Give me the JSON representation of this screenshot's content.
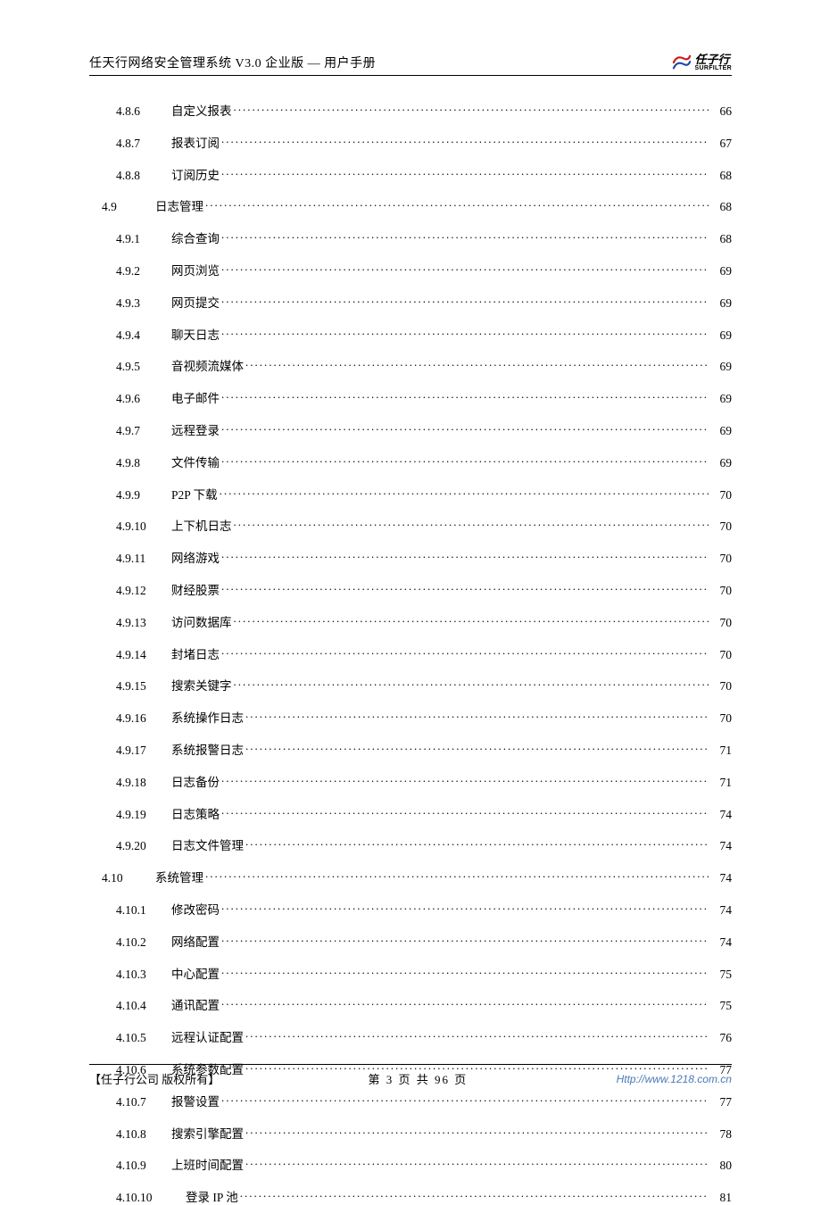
{
  "header": {
    "title": "任天行网络安全管理系统 V3.0 企业版 — 用户手册",
    "logo_cn": "任子行",
    "logo_en": "SURFILTER"
  },
  "toc": [
    {
      "level": 3,
      "num": "4.8.6",
      "title": "自定义报表",
      "page": "66"
    },
    {
      "level": 3,
      "num": "4.8.7",
      "title": "报表订阅",
      "page": "67"
    },
    {
      "level": 3,
      "num": "4.8.8",
      "title": "订阅历史",
      "page": "68"
    },
    {
      "level": 2,
      "num": "4.9",
      "title": "日志管理",
      "page": "68"
    },
    {
      "level": 3,
      "num": "4.9.1",
      "title": "综合查询",
      "page": "68"
    },
    {
      "level": 3,
      "num": "4.9.2",
      "title": "网页浏览",
      "page": "69"
    },
    {
      "level": 3,
      "num": "4.9.3",
      "title": "网页提交",
      "page": "69"
    },
    {
      "level": 3,
      "num": "4.9.4",
      "title": "聊天日志",
      "page": "69"
    },
    {
      "level": 3,
      "num": "4.9.5",
      "title": "音视频流媒体",
      "page": "69"
    },
    {
      "level": 3,
      "num": "4.9.6",
      "title": "电子邮件",
      "page": "69"
    },
    {
      "level": 3,
      "num": "4.9.7",
      "title": "远程登录",
      "page": "69"
    },
    {
      "level": 3,
      "num": "4.9.8",
      "title": "文件传输",
      "page": "69"
    },
    {
      "level": 3,
      "num": "4.9.9",
      "title": "P2P 下载",
      "page": "70"
    },
    {
      "level": 3,
      "num": "4.9.10",
      "title": "上下机日志",
      "page": "70"
    },
    {
      "level": 3,
      "num": "4.9.11",
      "title": "网络游戏",
      "page": "70"
    },
    {
      "level": 3,
      "num": "4.9.12",
      "title": "财经股票",
      "page": "70"
    },
    {
      "level": 3,
      "num": "4.9.13",
      "title": "访问数据库",
      "page": "70"
    },
    {
      "level": 3,
      "num": "4.9.14",
      "title": "封堵日志",
      "page": "70"
    },
    {
      "level": 3,
      "num": "4.9.15",
      "title": "搜索关键字",
      "page": "70"
    },
    {
      "level": 3,
      "num": "4.9.16",
      "title": "系统操作日志",
      "page": "70"
    },
    {
      "level": 3,
      "num": "4.9.17",
      "title": "系统报警日志",
      "page": "71"
    },
    {
      "level": 3,
      "num": "4.9.18",
      "title": "日志备份",
      "page": "71"
    },
    {
      "level": 3,
      "num": "4.9.19",
      "title": "日志策略",
      "page": "74"
    },
    {
      "level": 3,
      "num": "4.9.20",
      "title": "日志文件管理",
      "page": "74"
    },
    {
      "level": 2,
      "num": "4.10",
      "title": "系统管理",
      "page": "74"
    },
    {
      "level": 3,
      "num": "4.10.1",
      "title": "修改密码",
      "page": "74"
    },
    {
      "level": 3,
      "num": "4.10.2",
      "title": "网络配置",
      "page": "74"
    },
    {
      "level": 3,
      "num": "4.10.3",
      "title": "中心配置",
      "page": "75"
    },
    {
      "level": 3,
      "num": "4.10.4",
      "title": "通讯配置",
      "page": "75"
    },
    {
      "level": 3,
      "num": "4.10.5",
      "title": "远程认证配置",
      "page": "76"
    },
    {
      "level": 3,
      "num": "4.10.6",
      "title": "系统参数配置",
      "page": "77"
    },
    {
      "level": 3,
      "num": "4.10.7",
      "title": "报警设置",
      "page": "77"
    },
    {
      "level": 3,
      "num": "4.10.8",
      "title": "搜索引擎配置",
      "page": "78"
    },
    {
      "level": 3,
      "num": "4.10.9",
      "title": "上班时间配置",
      "page": "80"
    },
    {
      "level": 3,
      "num": "4.10.10",
      "title": "登录 IP 池",
      "page": "81",
      "wide": true
    }
  ],
  "footer": {
    "left": "【任子行公司 版权所有】",
    "center": "第 3 页 共 96 页",
    "right": "Http://www.1218.com.cn"
  }
}
